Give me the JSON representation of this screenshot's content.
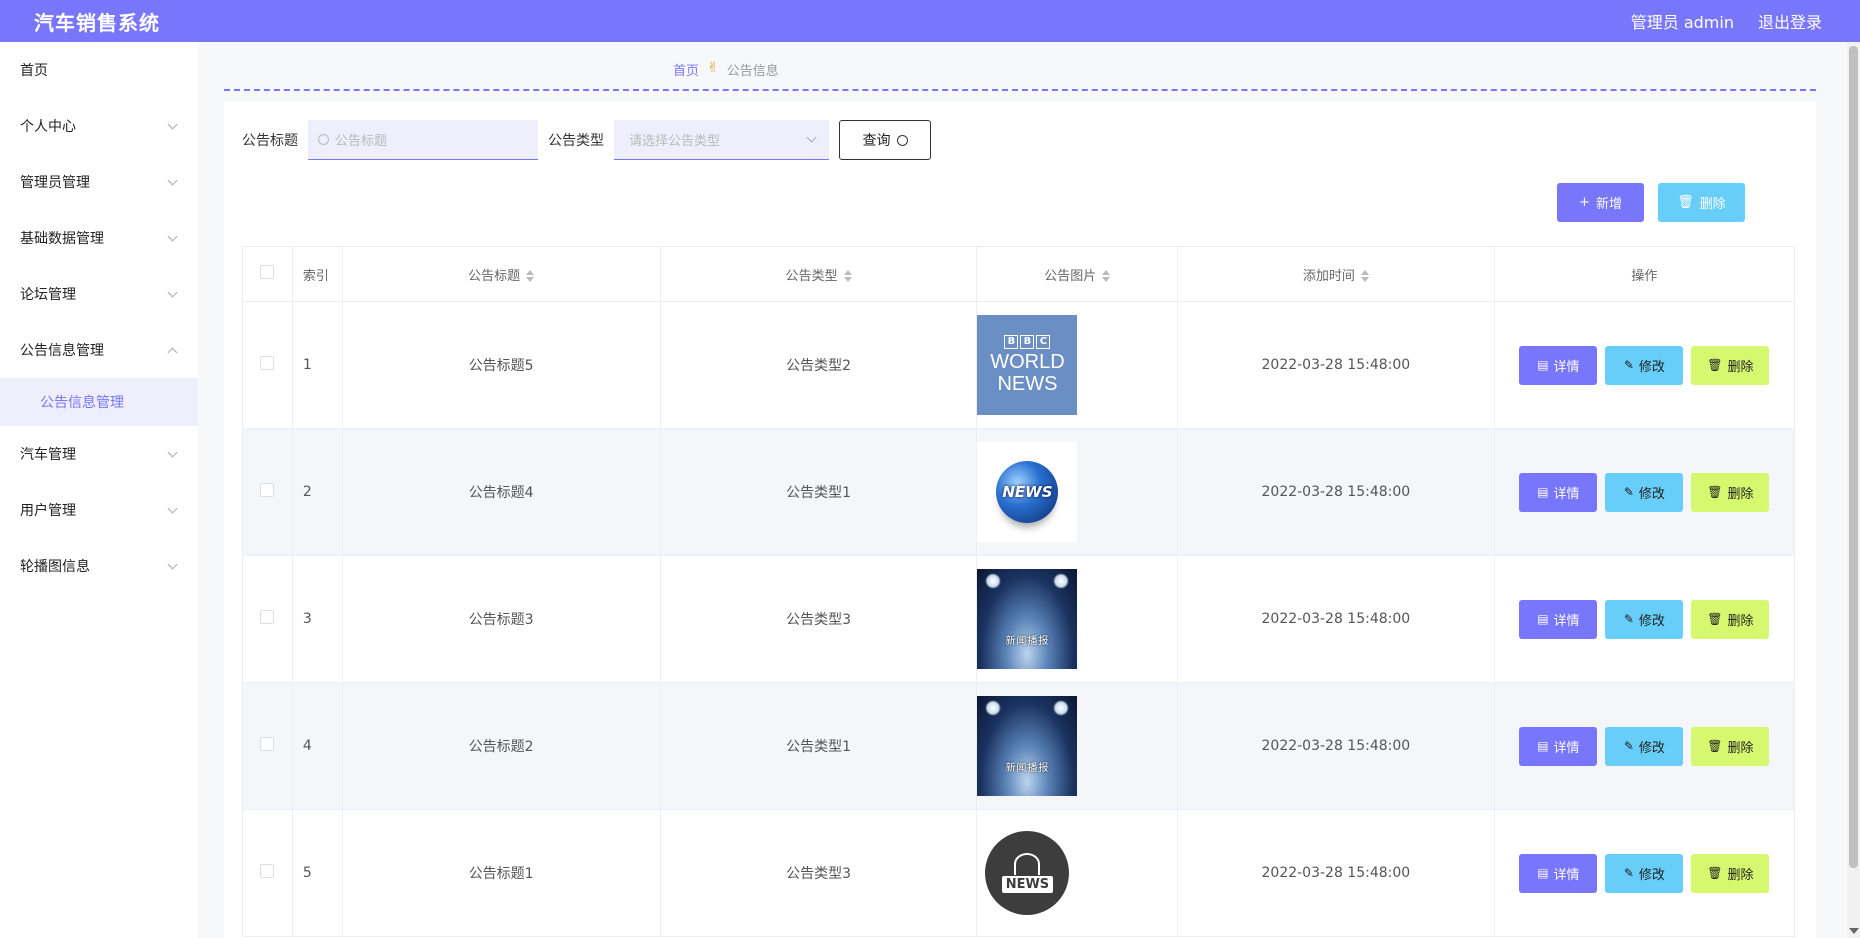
{
  "header": {
    "title": "汽车销售系统",
    "user": "管理员 admin",
    "logout": "退出登录"
  },
  "sidebar": {
    "items": [
      {
        "label": "首页"
      },
      {
        "label": "个人中心"
      },
      {
        "label": "管理员管理"
      },
      {
        "label": "基础数据管理"
      },
      {
        "label": "论坛管理"
      },
      {
        "label": "公告信息管理"
      },
      {
        "label": "汽车管理"
      },
      {
        "label": "用户管理"
      },
      {
        "label": "轮播图信息"
      }
    ],
    "sub_active": "公告信息管理"
  },
  "breadcrumb": {
    "home": "首页",
    "current": "公告信息"
  },
  "search": {
    "title_label": "公告标题",
    "title_placeholder": "公告标题",
    "type_label": "公告类型",
    "type_placeholder": "请选择公告类型",
    "query_button": "查询"
  },
  "actions": {
    "add": "新增",
    "delete": "删除"
  },
  "table": {
    "columns": [
      "索引",
      "公告标题",
      "公告类型",
      "公告图片",
      "添加时间",
      "操作"
    ],
    "rows": [
      {
        "index": "1",
        "title": "公告标题5",
        "type": "公告类型2",
        "image": "bbc-world-news",
        "time": "2022-03-28 15:48:00"
      },
      {
        "index": "2",
        "title": "公告标题4",
        "type": "公告类型1",
        "image": "news-globe",
        "time": "2022-03-28 15:48:00"
      },
      {
        "index": "3",
        "title": "公告标题3",
        "type": "公告类型3",
        "image": "news-stage",
        "time": "2022-03-28 15:48:00"
      },
      {
        "index": "4",
        "title": "公告标题2",
        "type": "公告类型1",
        "image": "news-stage",
        "time": "2022-03-28 15:48:00"
      },
      {
        "index": "5",
        "title": "公告标题1",
        "type": "公告类型3",
        "image": "news-circle",
        "time": "2022-03-28 15:48:00"
      }
    ],
    "row_actions": {
      "detail": "详情",
      "edit": "修改",
      "delete": "删除"
    }
  },
  "image_text": {
    "bbc_letters": [
      "B",
      "B",
      "C"
    ],
    "bbc_line1": "WORLD",
    "bbc_line2": "NEWS",
    "globe": "NEWS",
    "stage": "新闻播报",
    "circle": "NEWS"
  },
  "colors": {
    "primary": "#7876fb",
    "info": "#67cdf9",
    "warning": "#d6f86f"
  }
}
